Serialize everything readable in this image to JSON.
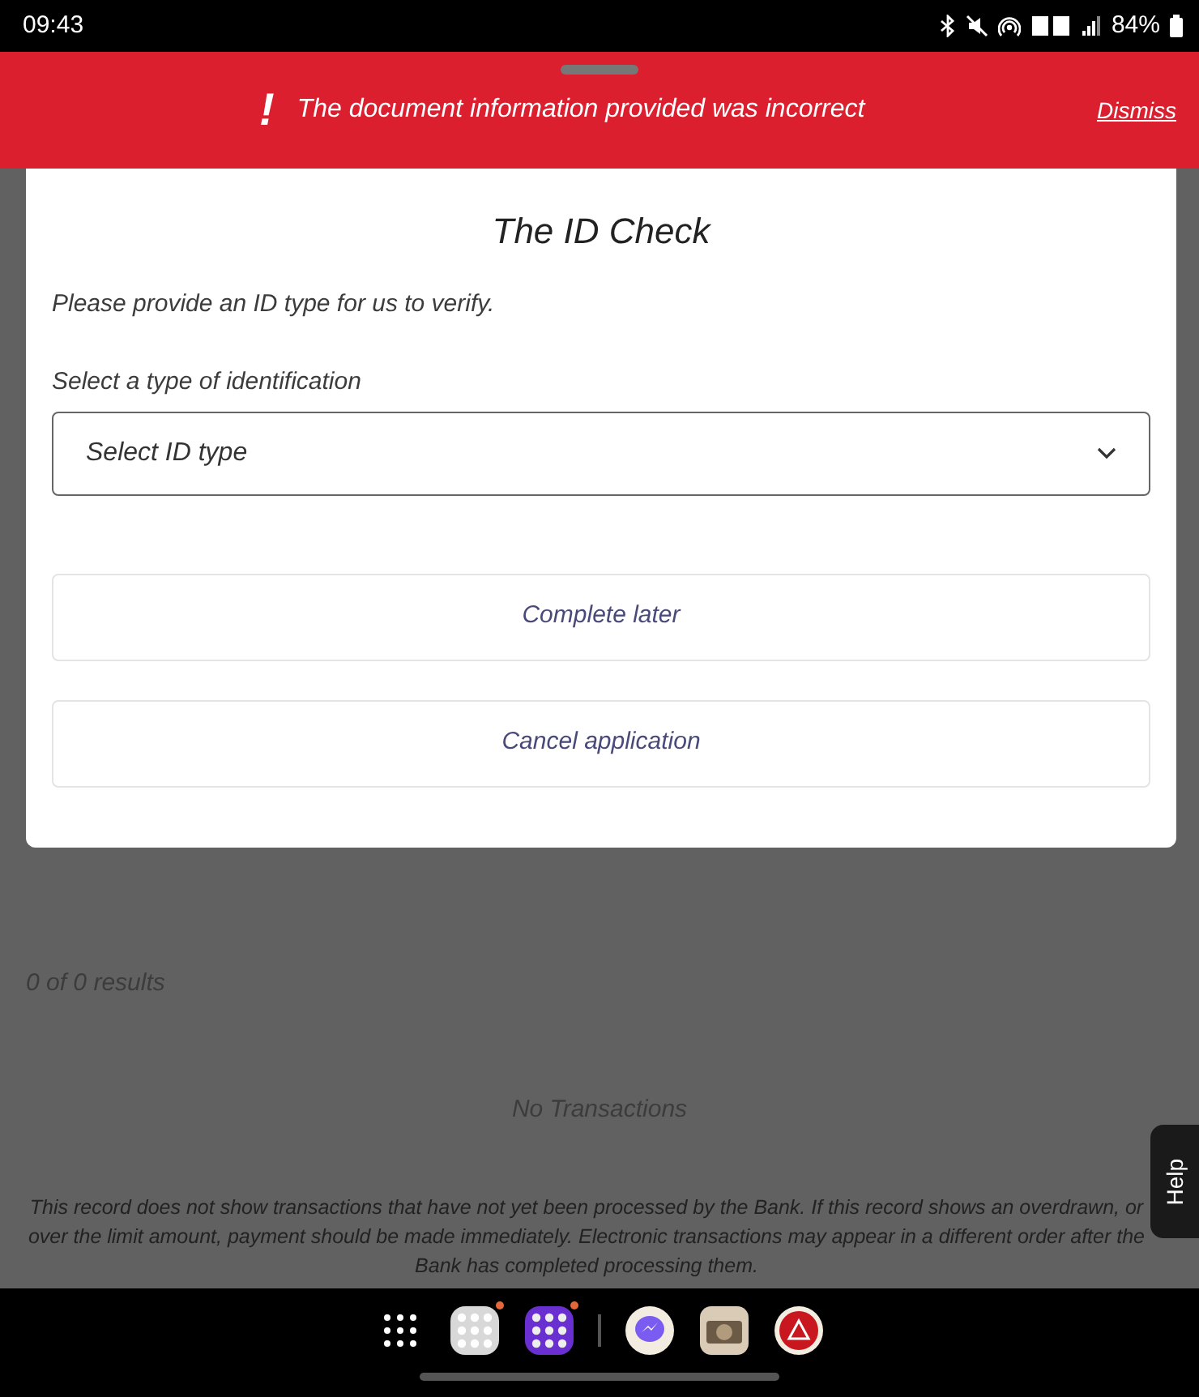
{
  "status_bar": {
    "time": "09:43",
    "battery": "84%"
  },
  "banner": {
    "icon": "!",
    "message": "The document information provided was incorrect",
    "action": "Dismiss"
  },
  "modal": {
    "title": "The ID Check",
    "instruction": "Please provide an ID type for us to verify.",
    "field_label": "Select a type of identification",
    "select": {
      "placeholder": "Select ID type"
    },
    "buttons": [
      "Complete later",
      "Cancel application"
    ]
  },
  "page": {
    "results": "0 of 0 results",
    "empty": "No Transactions",
    "disclaimer": "This record does not show transactions that have not yet been processed by the Bank. If this record shows an overdrawn, or over the limit amount, payment should be made immediately. Electronic transactions may appear in a different order after the Bank has completed processing them.",
    "help": "Help"
  },
  "dock": [
    {
      "kind": "apps",
      "badge": false
    },
    {
      "kind": "folder",
      "badge": true
    },
    {
      "kind": "folder2",
      "badge": true
    },
    {
      "kind": "chat",
      "badge": false
    },
    {
      "kind": "camera",
      "badge": false
    },
    {
      "kind": "pdf",
      "badge": false
    }
  ]
}
